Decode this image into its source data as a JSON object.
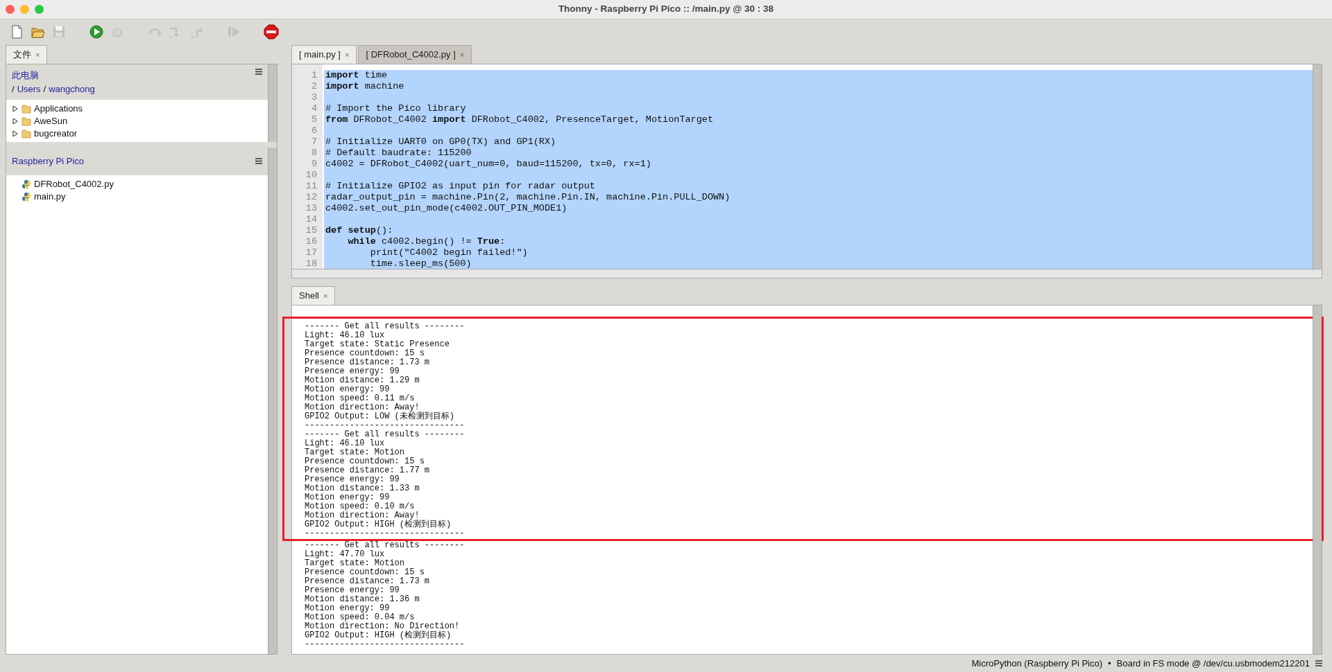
{
  "window": {
    "title": "Thonny  -  Raspberry Pi Pico :: /main.py  @  30 : 38"
  },
  "toolbar": [
    {
      "kind": "new",
      "disabled": false
    },
    {
      "kind": "open",
      "disabled": false
    },
    {
      "kind": "save",
      "disabled": true
    },
    {
      "kind": "run",
      "disabled": false
    },
    {
      "kind": "debug",
      "disabled": true
    },
    {
      "kind": "step-over",
      "disabled": true
    },
    {
      "kind": "step-into",
      "disabled": true
    },
    {
      "kind": "step-out",
      "disabled": true
    },
    {
      "kind": "resume",
      "disabled": true
    },
    {
      "kind": "stop",
      "disabled": false
    }
  ],
  "files_panel": {
    "tab": {
      "label": "文件",
      "close": "×",
      "selected": true
    },
    "computer": {
      "title": "此电脑",
      "path": [
        {
          "separator": "/",
          "folder": "Users"
        },
        {
          "separator": "/",
          "folder": "wangchong"
        }
      ],
      "items": [
        {
          "name": "Applications",
          "expanded": false
        },
        {
          "name": "AweSun",
          "expanded": false
        },
        {
          "name": "bugcreator",
          "expanded": false
        }
      ]
    },
    "device": {
      "title": "Raspberry Pi Pico",
      "files": [
        "DFRobot_C4002.py",
        "main.py"
      ]
    }
  },
  "editor": {
    "tabs": [
      {
        "label": "[ main.py ]",
        "close": "×",
        "selected": true
      },
      {
        "label": "[ DFRobot_C4002.py ]",
        "close": "×",
        "selected": false
      }
    ],
    "lines": [
      {
        "number": "1",
        "code": "**import** time",
        "selected": true
      },
      {
        "number": "2",
        "code": "**import** machine",
        "selected": true
      },
      {
        "number": "3",
        "selected": true
      },
      {
        "number": "4",
        "code": "# Import the Pico library",
        "selected": true
      },
      {
        "number": "5",
        "code": "**from** DFRobot_C4002 **import** DFRobot_C4002, PresenceTarget, MotionTarget",
        "selected": true
      },
      {
        "number": "6",
        "selected": true
      },
      {
        "number": "7",
        "code": "# Initialize UART0 on GP0(TX) and GP1(RX)",
        "selected": true
      },
      {
        "number": "8",
        "code": "# Default baudrate: 115200",
        "selected": true
      },
      {
        "number": "9",
        "code": "c4002 = DFRobot_C4002(uart_num=0, baud=115200, tx=0, rx=1)",
        "selected": true
      },
      {
        "number": "10",
        "selected": true
      },
      {
        "number": "11",
        "code": "# Initialize GPIO2 as input pin for radar output",
        "selected": true
      },
      {
        "number": "12",
        "code": "radar_output_pin = machine.Pin(2, machine.Pin.IN, machine.Pin.PULL_DOWN)",
        "selected": true
      },
      {
        "number": "13",
        "code": "c4002.set_out_pin_mode(c4002.OUT_PIN_MODE1)",
        "selected": true
      },
      {
        "number": "14",
        "selected": true
      },
      {
        "number": "15",
        "code": "**def** **setup**():",
        "selected": true
      },
      {
        "number": "16",
        "code": "    **while** c4002.begin() != **True**:",
        "selected": true
      },
      {
        "number": "17",
        "code": "        print(\"C4002 begin failed!\")",
        "selected": true
      },
      {
        "number": "18",
        "code": "        time.sleep_ms(500)",
        "selected": true
      }
    ]
  },
  "shell": {
    "tab": {
      "label": "Shell",
      "close": "×",
      "selected": true
    },
    "blocks": [
      {
        "highlighted": true,
        "lines": [
          "------- Get all results --------",
          "Light: 46.10 lux",
          "Target state: Static Presence",
          "Presence countdown: 15 s",
          "Presence distance: 1.73 m",
          "Presence energy: 99",
          "Motion distance: 1.29 m",
          "Motion energy: 99",
          "Motion speed: 0.11 m/s",
          "Motion direction: Away!",
          "GPIO2 Output: LOW (未检测到目标)",
          "--------------------------------",
          "------- Get all results --------",
          "Light: 46.10 lux",
          "Target state: Motion",
          "Presence countdown: 15 s",
          "Presence distance: 1.77 m",
          "Presence energy: 99",
          "Motion distance: 1.33 m",
          "Motion energy: 99",
          "Motion speed: 0.10 m/s",
          "Motion direction: Away!",
          "GPIO2 Output: HIGH (检测到目标)",
          "--------------------------------"
        ]
      },
      {
        "highlighted": false,
        "lines": [
          "------- Get all results --------",
          "Light: 47.70 lux",
          "Target state: Motion",
          "Presence countdown: 15 s",
          "Presence distance: 1.73 m",
          "Presence energy: 99",
          "Motion distance: 1.36 m",
          "Motion energy: 99",
          "Motion speed: 0.04 m/s",
          "Motion direction: No Direction!",
          "GPIO2 Output: HIGH (检测到目标)",
          "--------------------------------"
        ]
      }
    ]
  },
  "status_bar": {
    "interpreter": "MicroPython (Raspberry Pi Pico)",
    "separator": "•",
    "port": "Board in FS mode @ /dev/cu.usbmodem212201"
  }
}
